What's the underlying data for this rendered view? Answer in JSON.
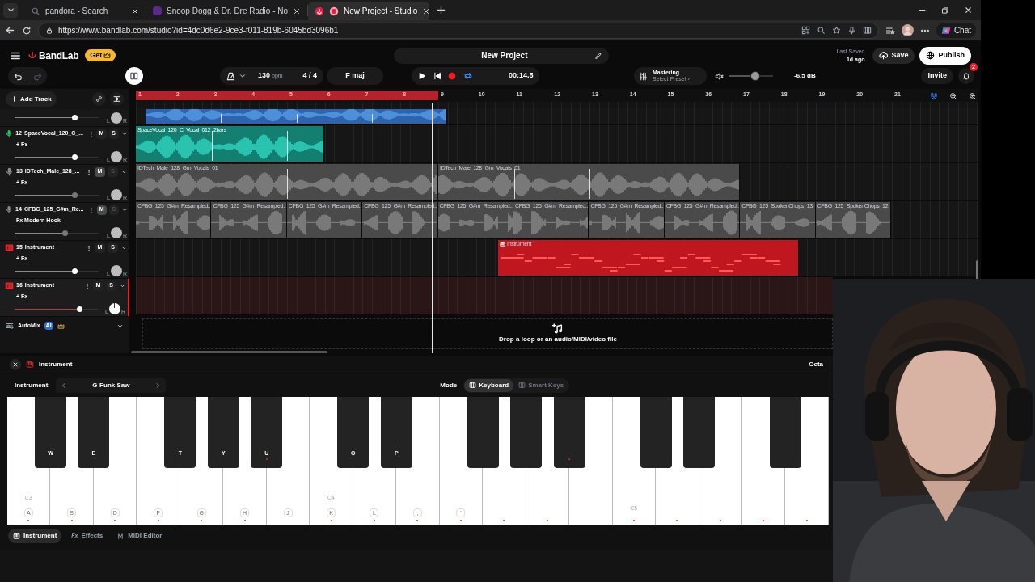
{
  "browser": {
    "tabs": [
      {
        "title": "pandora - Search",
        "selected": false,
        "kind": "search"
      },
      {
        "title": "Snoop Dogg & Dr. Dre Radio - No",
        "selected": false,
        "kind": "radio"
      },
      {
        "title": "New Project - Studio",
        "selected": true,
        "kind": "studio"
      }
    ],
    "url": "https://www.bandlab.com/studio?id=4dc0d6e2-9ce3-f011-819b-6045bd3096b1",
    "chat_label": "Chat"
  },
  "app": {
    "logo": "BandLab",
    "get_label": "Get",
    "project_title": "New Project",
    "last_saved_label": "Last Saved",
    "last_saved_time": "1d ago",
    "save_label": "Save",
    "publish_label": "Publish"
  },
  "transport": {
    "tempo": "130",
    "tempo_unit": "bpm",
    "time_signature": "4 / 4",
    "key": "F maj",
    "time": "00:14.5",
    "loop_enabled": true,
    "mastering_title": "Mastering",
    "mastering_preset": "Select Preset ›",
    "volume": {
      "level": 0.6
    },
    "volume_reading": "-6.5 dB",
    "invite_label": "Invite",
    "notifications": "2"
  },
  "timeline": {
    "add_track_label": "Add Track",
    "snap_enabled": true,
    "drop_hint": "Drop a loop or an audio/MIDI/video file",
    "ruler": [
      {
        "label": "1",
        "in_loop": true
      },
      {
        "label": "2",
        "in_loop": true
      },
      {
        "label": "3",
        "in_loop": true
      },
      {
        "label": "4",
        "in_loop": true
      },
      {
        "label": "5",
        "in_loop": true
      },
      {
        "label": "6",
        "in_loop": true
      },
      {
        "label": "7",
        "in_loop": true
      },
      {
        "label": "8",
        "in_loop": true
      },
      {
        "label": "9",
        "in_loop": false
      },
      {
        "label": "10",
        "in_loop": false
      },
      {
        "label": "11",
        "in_loop": false
      },
      {
        "label": "12",
        "in_loop": false
      },
      {
        "label": "13",
        "in_loop": false
      },
      {
        "label": "14",
        "in_loop": false
      },
      {
        "label": "15",
        "in_loop": false
      },
      {
        "label": "16",
        "in_loop": false
      },
      {
        "label": "17",
        "in_loop": false
      },
      {
        "label": "18",
        "in_loop": false
      },
      {
        "label": "19",
        "in_loop": false
      },
      {
        "label": "20",
        "in_loop": false
      },
      {
        "label": "21",
        "in_loop": false
      }
    ]
  },
  "tracks": [
    {
      "kind": "cut",
      "level": 0.71,
      "pan_left": "L",
      "pan_right": "R",
      "clips": [
        {
          "color": "#2e64ad"
        }
      ]
    },
    {
      "kind": "audio",
      "number": "12",
      "name": "SpaceVocal_120_C_...",
      "fx": "+ Fx",
      "mute_label": "M",
      "solo_label": "S",
      "muted": false,
      "selected": false,
      "color": "#22c55e",
      "level": 0.71,
      "pan_left": "L",
      "pan_right": "R",
      "clips": [
        {
          "label": "SpaceVocal_120_C_Vocal_012_2bars",
          "color": "#137f70"
        }
      ]
    },
    {
      "kind": "audio",
      "number": "13",
      "name": "IDTech_Male_128_...",
      "fx": "+ Fx",
      "mute_label": "M",
      "solo_label": "S",
      "muted": true,
      "selected": false,
      "color": "#8a8a8a",
      "level": 0.71,
      "pan_left": "L",
      "pan_right": "R",
      "clips": [
        {
          "label": "IDTech_Male_128_Gm_Vocals_01",
          "color": "#4a4a4a"
        },
        {
          "label": "IDTech_Male_128_Gm_Vocals_01",
          "color": "#4a4a4a"
        }
      ]
    },
    {
      "kind": "audio",
      "number": "14",
      "name": "CFBG_125_G#m_Re...",
      "fx": "Fx Modern Hook",
      "mute_label": "M",
      "solo_label": "S",
      "muted": true,
      "selected": false,
      "color": "#8a8a8a",
      "level": 0.6,
      "pan_left": "L",
      "pan_right": "R",
      "clips": [
        {
          "label": "CFBG_125_G#m_Resampled...",
          "color": "#4a4a4a"
        },
        {
          "label": "CFBG_125_G#m_Resampled...",
          "color": "#4a4a4a"
        },
        {
          "label": "CFBG_125_G#m_Resampled...",
          "color": "#4a4a4a"
        },
        {
          "label": "CFBG_125_G#m_Resampled...",
          "color": "#4a4a4a"
        },
        {
          "label": "CFBG_125_G#m_Resampled...",
          "color": "#4a4a4a"
        },
        {
          "label": "CFBG_125_G#m_Resampled...",
          "color": "#4a4a4a"
        },
        {
          "label": "CFBG_125_G#m_Resampled...",
          "color": "#4a4a4a"
        },
        {
          "label": "CFBG_125_G#m_Resampled...",
          "color": "#4a4a4a"
        },
        {
          "label": "CFBG_125_SpokenChops_13",
          "color": "#4a4a4a"
        },
        {
          "label": "CFBG_125_SpokenChops_12",
          "color": "#4a4a4a"
        }
      ]
    },
    {
      "kind": "midi",
      "number": "15",
      "name": "Instrument",
      "fx": "+ Fx",
      "mute_label": "M",
      "solo_label": "S",
      "muted": false,
      "selected": false,
      "color": "#dc2626",
      "level": 0.71,
      "pan_left": "L",
      "pan_right": "R",
      "clips": [
        {
          "label": "Instrument",
          "color": "#c0161f"
        }
      ]
    },
    {
      "kind": "midi",
      "number": "16",
      "name": "Instrument",
      "fx": "+ Fx",
      "mute_label": "M",
      "solo_label": "S",
      "muted": false,
      "selected": true,
      "color": "#dc2626",
      "level": 0.77,
      "pan_left": "L",
      "pan_right": "R"
    }
  ],
  "automix": {
    "label": "AutoMix",
    "badge": "AI"
  },
  "instrument_panel": {
    "title": "Instrument",
    "octave_label": "Octa",
    "instrument_label": "Instrument",
    "instrument_name": "G-Funk Saw",
    "mode_label": "Mode",
    "modes": [
      {
        "label": "Keyboard",
        "selected": true
      },
      {
        "label": "Smart Keys",
        "selected": false
      }
    ],
    "keyboard": {
      "white_keys": [
        {
          "octave": "C3",
          "label": "A",
          "in_scale": true,
          "black_key": {
            "label": "W",
            "in_scale": false
          }
        },
        {
          "label": "S",
          "in_scale": true,
          "black_key": {
            "label": "E",
            "in_scale": false
          }
        },
        {
          "label": "D",
          "in_scale": true
        },
        {
          "label": "F",
          "in_scale": true,
          "black_key": {
            "label": "T",
            "in_scale": false
          }
        },
        {
          "label": "G",
          "in_scale": true,
          "black_key": {
            "label": "Y",
            "in_scale": false
          }
        },
        {
          "label": "H",
          "in_scale": true,
          "black_key": {
            "label": "U",
            "in_scale": true
          }
        },
        {
          "label": "J",
          "in_scale": false
        },
        {
          "octave": "C4",
          "label": "K",
          "in_scale": true,
          "black_key": {
            "label": "O",
            "in_scale": false
          }
        },
        {
          "label": "L",
          "in_scale": true,
          "black_key": {
            "label": "P",
            "in_scale": false
          }
        },
        {
          "label": ";",
          "in_scale": true
        },
        {
          "label": "'",
          "in_scale": true,
          "black_key": {
            "in_scale": false
          }
        },
        {
          "in_scale": true,
          "black_key": {
            "in_scale": false
          }
        },
        {
          "in_scale": true,
          "black_key": {
            "in_scale": true
          }
        },
        {
          "in_scale": false
        },
        {
          "octave": "C5",
          "in_scale": true,
          "black_key": {
            "in_scale": false
          }
        },
        {
          "in_scale": true,
          "black_key": {
            "in_scale": false
          }
        },
        {
          "in_scale": true
        },
        {
          "in_scale": true,
          "black_key": {
            "in_scale": false
          }
        },
        {
          "in_scale": true
        }
      ]
    },
    "tabs": [
      {
        "label": "Instrument",
        "selected": true,
        "kind": "instrument"
      },
      {
        "label": "Effects",
        "selected": false,
        "kind": "effects",
        "glyph": "Fx"
      },
      {
        "label": "MIDI Editor",
        "selected": false,
        "kind": "midi"
      }
    ]
  }
}
